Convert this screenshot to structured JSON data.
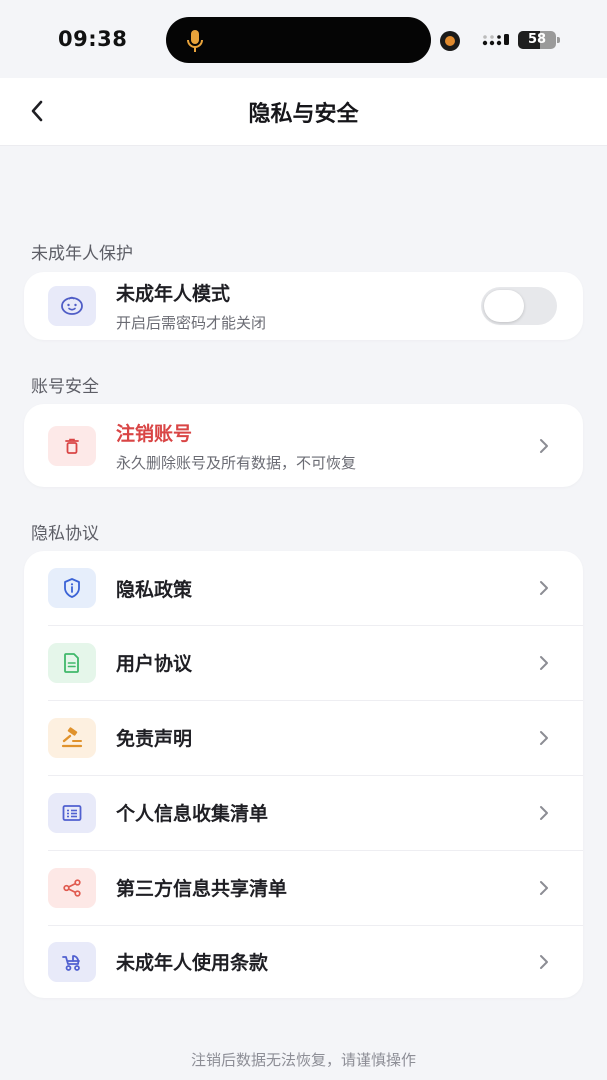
{
  "status_bar": {
    "time": "09:38",
    "battery": "58"
  },
  "nav": {
    "title": "隐私与安全"
  },
  "sections": {
    "minor": {
      "title": "未成年人保护",
      "item": {
        "label": "未成年人模式",
        "sub": "开启后需密码才能关闭",
        "icon": "child-face-icon",
        "toggle_on": false
      }
    },
    "account": {
      "title": "账号安全",
      "item": {
        "label": "注销账号",
        "sub": "永久删除账号及所有数据，不可恢复",
        "icon": "trash-icon",
        "label_color": "#d94545"
      }
    },
    "privacy": {
      "title": "隐私协议",
      "items": [
        {
          "label": "隐私政策",
          "icon": "shield-info-icon"
        },
        {
          "label": "用户协议",
          "icon": "document-icon"
        },
        {
          "label": "免责声明",
          "icon": "gavel-icon"
        },
        {
          "label": "个人信息收集清单",
          "icon": "list-icon"
        },
        {
          "label": "第三方信息共享清单",
          "icon": "share-icon"
        },
        {
          "label": "未成年人使用条款",
          "icon": "stroller-icon"
        }
      ]
    }
  },
  "footer": {
    "note": "注销后数据无法恢复，请谨慎操作"
  },
  "colors": {
    "danger": "#d94545",
    "page_bg": "#f4f5f8",
    "blue_icon": "#3b63d6",
    "green_icon": "#3fb86a",
    "orange_icon": "#e0922c",
    "indigo_icon": "#5060d0",
    "red_icon": "#e05a4f"
  }
}
